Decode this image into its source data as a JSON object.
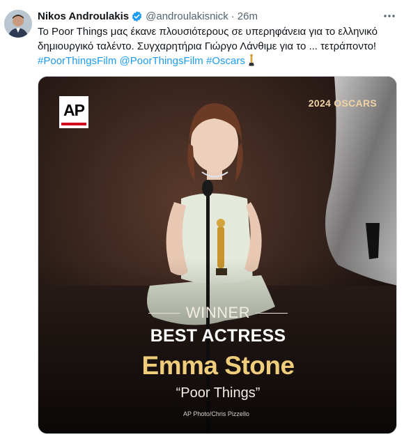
{
  "author": {
    "name": "Nikos Androulakis",
    "handle": "@androulakisnick",
    "separator": "·",
    "time": "26m",
    "verified_color": "#1d9bf0"
  },
  "tweet": {
    "text_line1": "Το Poor Things μας έκανε πλουσιότερους σε υπερηφάνεια για το ελληνικό",
    "text_line2": "δημιουργικό ταλέντο. Συγχαρητήρια Γιώργο Λάνθιμε για το ... τετράποντο!",
    "hashtags": [
      "#PoorThingsFilm",
      "@PoorThingsFilm",
      "#Oscars"
    ],
    "link_color": "#1d9bf0"
  },
  "media": {
    "logo_text": "AP",
    "badge": "2024 OSCARS",
    "winner_label": "WINNER",
    "category": "BEST ACTRESS",
    "winner_name": "Emma Stone",
    "film": "“Poor Things”",
    "credit": "AP Photo/Chris Pizzello",
    "accent_gold": "#f0cd7a"
  },
  "icons": {
    "more": "more-options-icon",
    "verified": "verified-badge-icon",
    "trophy": "oscar-statuette-icon"
  }
}
